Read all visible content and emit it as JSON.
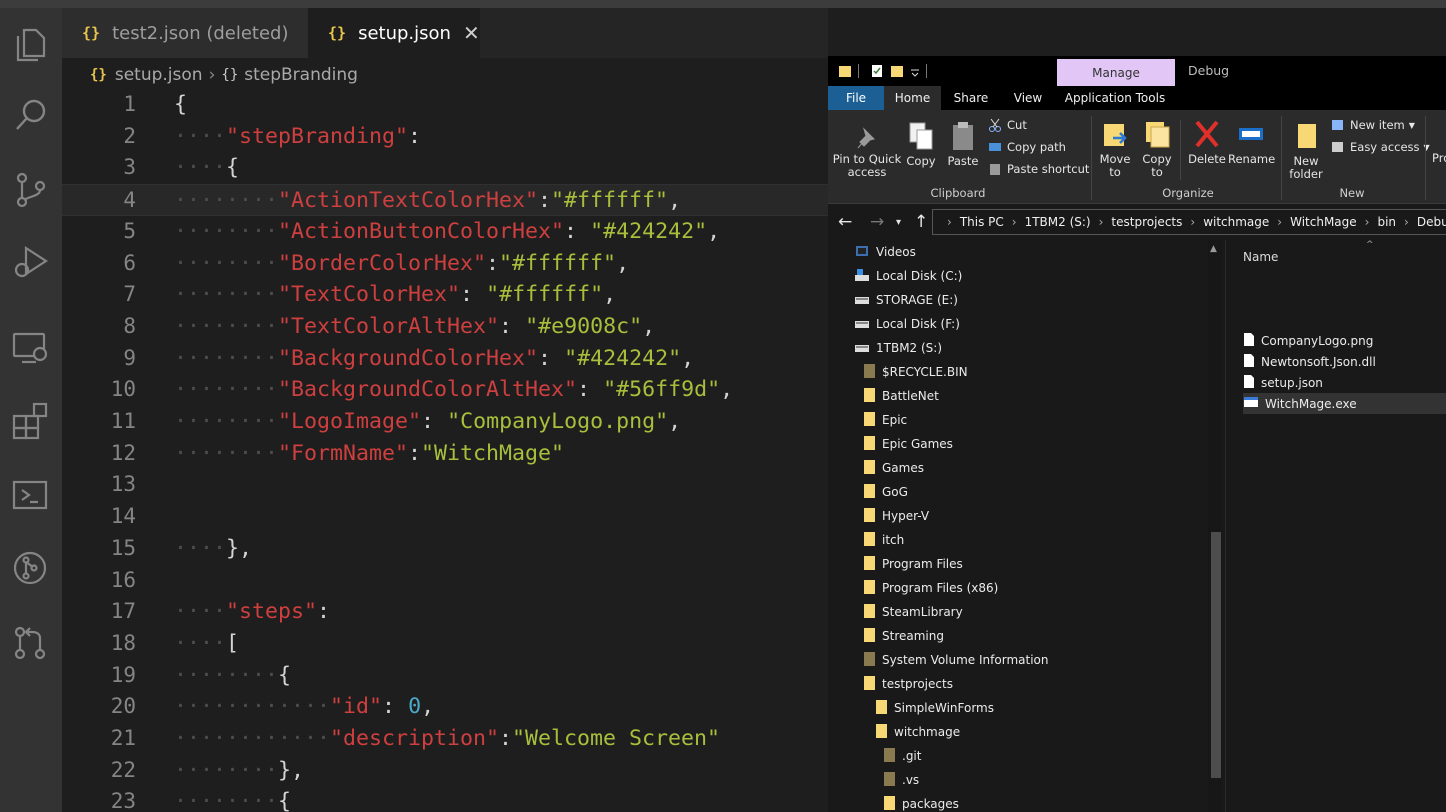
{
  "vscode": {
    "tabs": [
      {
        "icon": "{}",
        "label": "test2.json (deleted)"
      },
      {
        "icon": "{}",
        "label": "setup.json",
        "close": "✕"
      }
    ],
    "breadcrumb": {
      "file_icon": "{}",
      "file": "setup.json",
      "separator": "›",
      "symbol_icon": "{}",
      "symbol": "stepBranding"
    },
    "line_numbers": [
      "1",
      "2",
      "3",
      "4",
      "5",
      "6",
      "7",
      "8",
      "9",
      "10",
      "11",
      "12",
      "13",
      "14",
      "15",
      "16",
      "17",
      "18",
      "19",
      "20",
      "21",
      "22",
      "23"
    ],
    "code_lines": [
      "{",
      "    \"stepBranding\":",
      "    {",
      "        \"ActionTextColorHex\":\"#ffffff\",",
      "        \"ActionButtonColorHex\": \"#424242\",",
      "        \"BorderColorHex\":\"#ffffff\",",
      "        \"TextColorHex\": \"#ffffff\",",
      "        \"TextColorAltHex\": \"#e9008c\",",
      "        \"BackgroundColorHex\": \"#424242\",",
      "        \"BackgroundColorAltHex\": \"#56ff9d\",",
      "        \"LogoImage\": \"CompanyLogo.png\",",
      "        \"FormName\":\"WitchMage\"",
      "",
      "",
      "    },",
      "",
      "    \"steps\":",
      "    [",
      "        {",
      "            \"id\": 0,",
      "            \"description\":\"Welcome Screen\"",
      "        },",
      "        {"
    ],
    "activity_icons": [
      "files-icon",
      "search-icon",
      "source-control-icon",
      "run-debug-icon",
      "remote-explorer-icon",
      "extensions-icon",
      "terminal-icon",
      "git-graph-icon",
      "pull-request-icon"
    ],
    "colors": {
      "key": "#ce3f3f",
      "string": "#a8bf3c",
      "number": "#4aa9c9",
      "editor_bg": "#1e1e1e"
    }
  },
  "explorer": {
    "contextual_tab": "Manage",
    "window_title": "Debug",
    "ribbon_tabs": [
      "File",
      "Home",
      "Share",
      "View",
      "Application Tools"
    ],
    "clipboard": {
      "pin": "Pin to Quick access",
      "copy": "Copy",
      "paste": "Paste",
      "cut": "Cut",
      "copy_path": "Copy path",
      "paste_shortcut": "Paste shortcut",
      "group": "Clipboard"
    },
    "organize": {
      "move_to": "Move to",
      "copy_to": "Copy to",
      "delete": "Delete",
      "rename": "Rename",
      "group": "Organize"
    },
    "new_group": {
      "new_folder": "New folder",
      "new_item": "New item",
      "easy_access": "Easy access",
      "group": "New"
    },
    "cut_off_label": "Pro",
    "address": [
      "This PC",
      "1TBM2 (S:)",
      "testprojects",
      "witchmage",
      "WitchMage",
      "bin",
      "Debug"
    ],
    "nav_items": [
      {
        "label": "Videos",
        "icon": "videos-icon"
      },
      {
        "label": "Local Disk (C:)",
        "icon": "windows-drive-icon"
      },
      {
        "label": "STORAGE (E:)",
        "icon": "drive-icon"
      },
      {
        "label": "Local Disk (F:)",
        "icon": "drive-icon"
      },
      {
        "label": "1TBM2 (S:)",
        "icon": "drive-icon"
      },
      {
        "label": "$RECYCLE.BIN",
        "icon": "system-folder-icon"
      },
      {
        "label": "BattleNet",
        "icon": "folder-icon"
      },
      {
        "label": "Epic",
        "icon": "folder-icon"
      },
      {
        "label": "Epic Games",
        "icon": "folder-icon"
      },
      {
        "label": "Games",
        "icon": "folder-icon"
      },
      {
        "label": "GoG",
        "icon": "folder-icon"
      },
      {
        "label": "Hyper-V",
        "icon": "folder-icon"
      },
      {
        "label": "itch",
        "icon": "folder-icon"
      },
      {
        "label": "Program Files",
        "icon": "folder-icon"
      },
      {
        "label": "Program Files (x86)",
        "icon": "folder-icon"
      },
      {
        "label": "SteamLibrary",
        "icon": "folder-icon"
      },
      {
        "label": "Streaming",
        "icon": "folder-icon"
      },
      {
        "label": "System Volume Information",
        "icon": "system-folder-icon"
      },
      {
        "label": "testprojects",
        "icon": "folder-icon"
      },
      {
        "label": "SimpleWinForms",
        "icon": "folder-icon"
      },
      {
        "label": "witchmage",
        "icon": "folder-icon"
      },
      {
        "label": ".git",
        "icon": "system-folder-icon"
      },
      {
        "label": ".vs",
        "icon": "system-folder-icon"
      },
      {
        "label": "packages",
        "icon": "folder-icon"
      }
    ],
    "column_header": "Name",
    "files": [
      {
        "label": "CompanyLogo.png",
        "icon": "image-file-icon"
      },
      {
        "label": "Newtonsoft.Json.dll",
        "icon": "dll-file-icon"
      },
      {
        "label": "setup.json",
        "icon": "json-file-icon"
      },
      {
        "label": "WitchMage.exe",
        "icon": "exe-file-icon",
        "selected": true
      }
    ]
  }
}
